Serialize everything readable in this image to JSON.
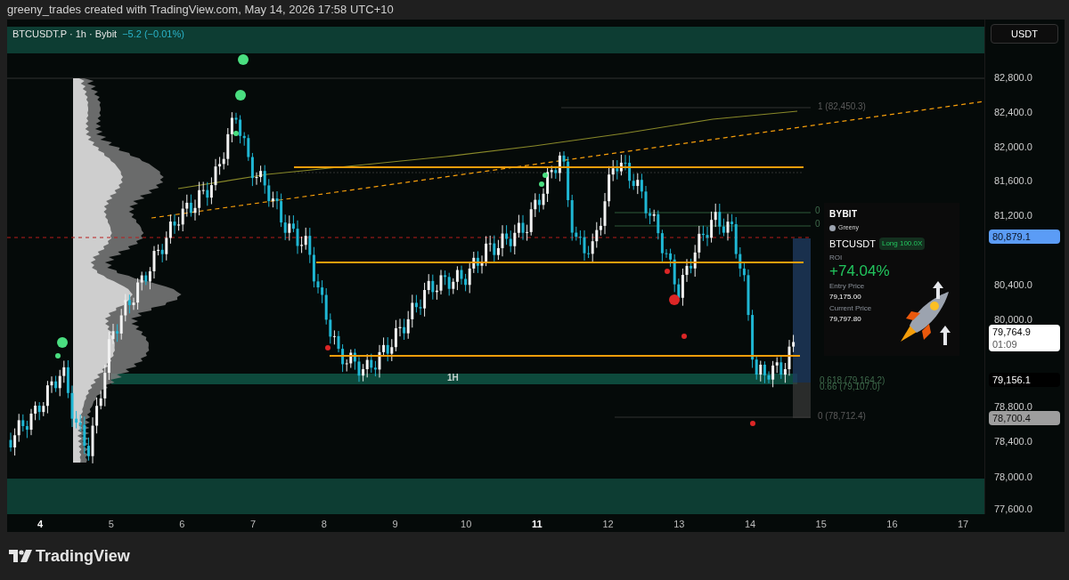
{
  "header": {
    "credit": "greeny_trades created with TradingView.com, May 14, 2026 17:58 UTC+10"
  },
  "legend": {
    "symbol": "BTCUSDT.P · 1h · Bybit",
    "change": "−5.2 (−0.01%)"
  },
  "currency_button": "USDT",
  "price_axis": {
    "ticks": [
      "82,800.0",
      "82,400.0",
      "82,000.0",
      "81,600.0",
      "81,200.0",
      "80,400.0",
      "80,000.0",
      "78,800.0",
      "78,400.0",
      "78,000.0",
      "77,600.0"
    ],
    "labels": [
      {
        "kind": "alert",
        "text": "80,879.1"
      },
      {
        "kind": "last",
        "text": "79,764.9",
        "countdown": "01:09"
      },
      {
        "kind": "level",
        "text": "79,156.1"
      },
      {
        "kind": "low",
        "text": "78,700.4"
      }
    ]
  },
  "time_axis": [
    {
      "label": "4",
      "emphasized": true
    },
    {
      "label": "5",
      "emphasized": false
    },
    {
      "label": "6",
      "emphasized": false
    },
    {
      "label": "7",
      "emphasized": false
    },
    {
      "label": "8",
      "emphasized": false
    },
    {
      "label": "9",
      "emphasized": false
    },
    {
      "label": "10",
      "emphasized": false
    },
    {
      "label": "11",
      "emphasized": true
    },
    {
      "label": "12",
      "emphasized": false
    },
    {
      "label": "13",
      "emphasized": false
    },
    {
      "label": "14",
      "emphasized": false
    },
    {
      "label": "15",
      "emphasized": false
    },
    {
      "label": "16",
      "emphasized": false
    },
    {
      "label": "17",
      "emphasized": false
    }
  ],
  "annotations": [
    {
      "kind": "fib",
      "text": "1 (82,450.3)"
    },
    {
      "kind": "fib",
      "text": "0"
    },
    {
      "kind": "fib",
      "text": "0"
    },
    {
      "kind": "zone",
      "text": "1H"
    },
    {
      "kind": "fib",
      "text": "0.618 (79,164.2)"
    },
    {
      "kind": "fib",
      "text": "0.66 (79,107.0)"
    },
    {
      "kind": "fib",
      "text": "0 (78,712.4)"
    }
  ],
  "position_card": {
    "logo": "BYBIT",
    "user": "Greeny",
    "pair": "BTCUSDT",
    "side": "Long 100.0X",
    "roi_label": "ROI",
    "roi": "+74.04%",
    "entry_label": "Entry Price",
    "entry": "79,175.00",
    "current_label": "Current Price",
    "current": "79,797.80"
  },
  "footer": {
    "logo": "TradingView"
  }
}
